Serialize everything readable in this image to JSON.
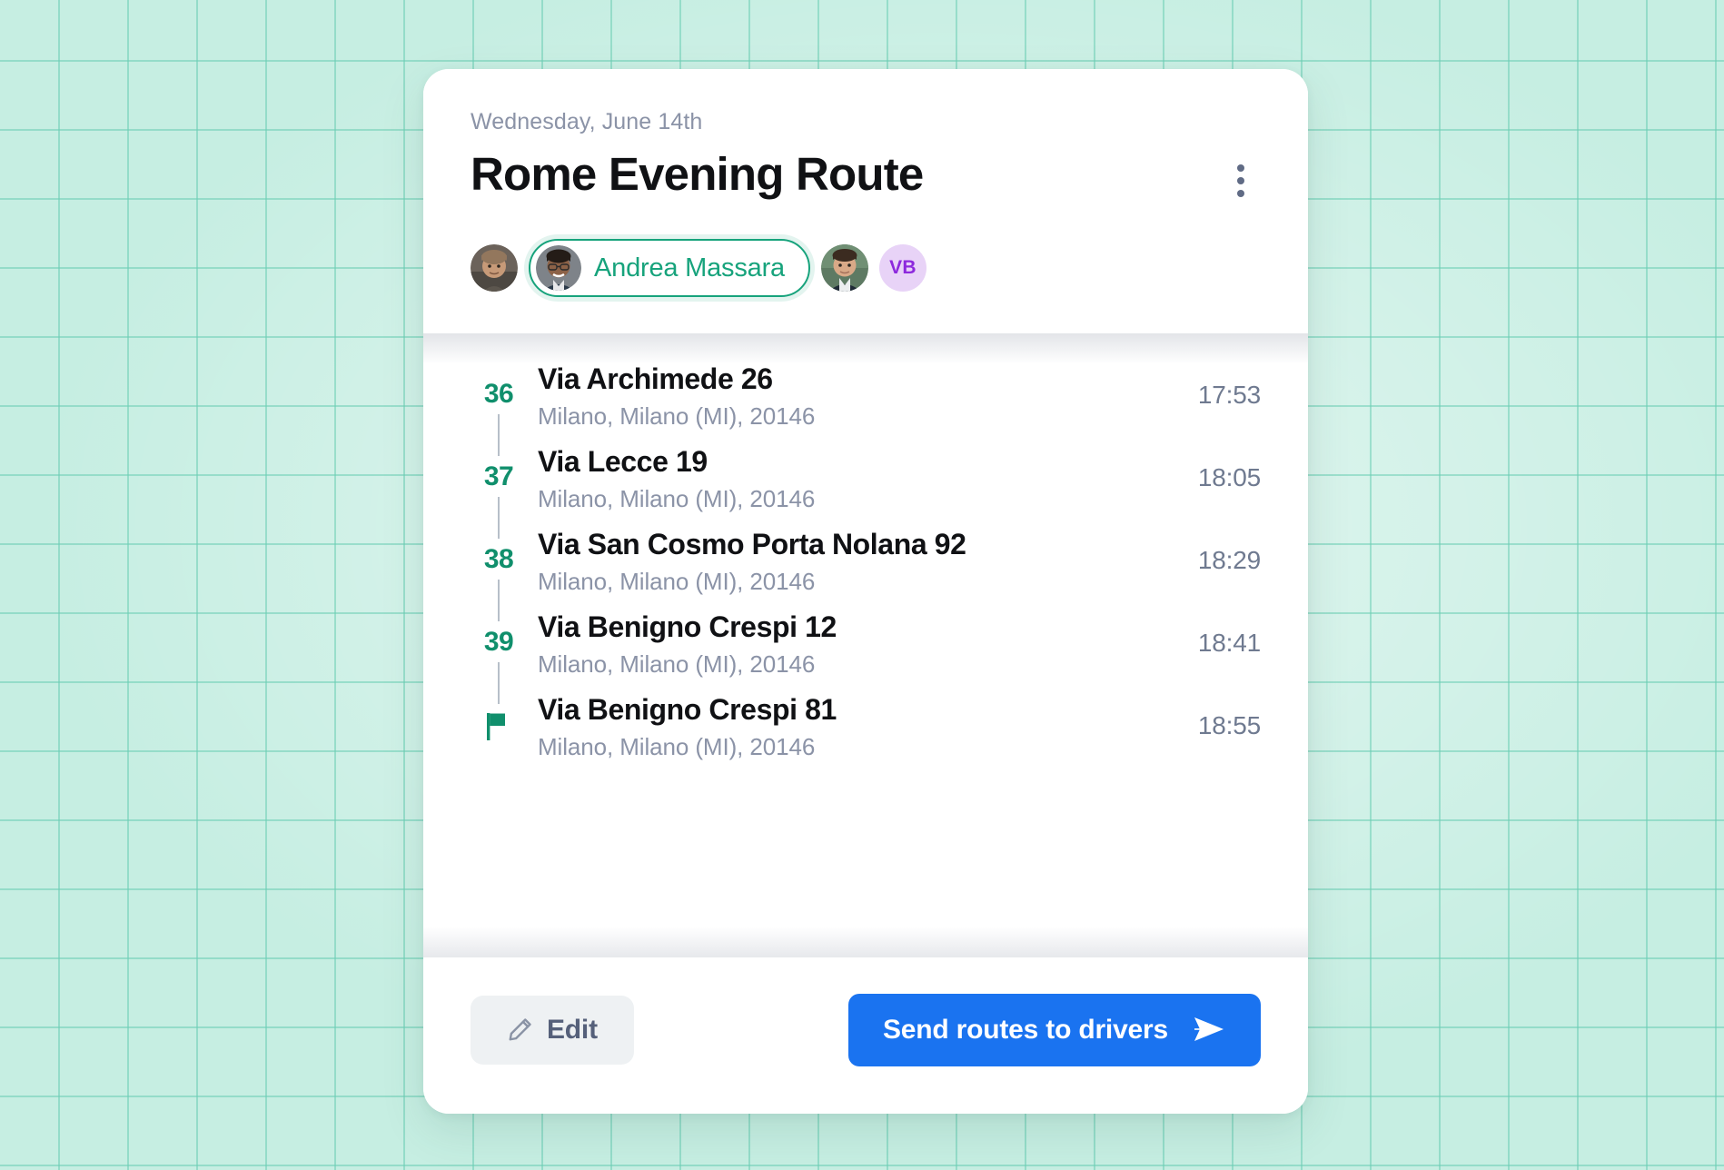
{
  "background": {
    "color": "#c6eee2",
    "grid_line_color": "#6ccdb4"
  },
  "card": {
    "header": {
      "date": "Wednesday, June 14th",
      "title": "Rome Evening Route",
      "menu_icon": "kebab-menu-icon"
    },
    "drivers": {
      "selected_name": "Andrea Massara",
      "selected_color": "#17a37c",
      "items": [
        {
          "type": "photo",
          "name": "driver-avatar-1"
        },
        {
          "type": "chip",
          "name": "Andrea Massara"
        },
        {
          "type": "photo",
          "name": "driver-avatar-3"
        },
        {
          "type": "initials",
          "name": "VB",
          "bg": "#e8d3f7",
          "fg": "#8d29dd"
        }
      ]
    },
    "stops": [
      {
        "index": "36",
        "marker": "number",
        "address": "Via Archimede 26",
        "locality": "Milano, Milano (MI), 20146",
        "time": "17:53"
      },
      {
        "index": "37",
        "marker": "number",
        "address": "Via Lecce 19",
        "locality": "Milano, Milano (MI), 20146",
        "time": "18:05"
      },
      {
        "index": "38",
        "marker": "number",
        "address": "Via San Cosmo Porta Nolana 92",
        "locality": "Milano, Milano (MI), 20146",
        "time": "18:29"
      },
      {
        "index": "39",
        "marker": "number",
        "address": "Via Benigno Crespi 12",
        "locality": "Milano, Milano (MI), 20146",
        "time": "18:41"
      },
      {
        "index": "",
        "marker": "flag",
        "address": "Via Benigno Crespi 81",
        "locality": "Milano, Milano (MI), 20146",
        "time": "18:55"
      }
    ],
    "footer": {
      "edit_label": "Edit",
      "edit_icon": "pencil-icon",
      "send_label": "Send routes to drivers",
      "send_icon": "send-arrow-icon",
      "send_color": "#1a73f0"
    }
  }
}
